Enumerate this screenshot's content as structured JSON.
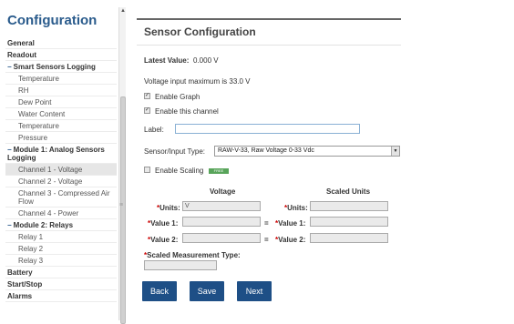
{
  "sidebar": {
    "title": "Configuration",
    "items": [
      {
        "label": "General",
        "kind": "lvl0"
      },
      {
        "label": "Readout",
        "kind": "lvl0"
      },
      {
        "label": "Smart Sensors Logging",
        "kind": "group"
      },
      {
        "label": "Temperature",
        "kind": "sub"
      },
      {
        "label": "RH",
        "kind": "sub"
      },
      {
        "label": "Dew Point",
        "kind": "sub"
      },
      {
        "label": "Water Content",
        "kind": "sub"
      },
      {
        "label": "Temperature",
        "kind": "sub"
      },
      {
        "label": "Pressure",
        "kind": "sub"
      },
      {
        "label": "Module 1: Analog Sensors Logging",
        "kind": "group-two"
      },
      {
        "label": "Channel 1 - Voltage",
        "kind": "sub-active"
      },
      {
        "label": "Channel 2 - Voltage",
        "kind": "sub"
      },
      {
        "label": "Channel 3 - Compressed Air Flow",
        "kind": "sub-two"
      },
      {
        "label": "Channel 4 - Power",
        "kind": "sub"
      },
      {
        "label": "Module 2: Relays",
        "kind": "group"
      },
      {
        "label": "Relay 1",
        "kind": "sub"
      },
      {
        "label": "Relay 2",
        "kind": "sub"
      },
      {
        "label": "Relay 3",
        "kind": "sub"
      },
      {
        "label": "Battery",
        "kind": "lvl0"
      },
      {
        "label": "Start/Stop",
        "kind": "lvl0"
      },
      {
        "label": "Alarms",
        "kind": "lvl0"
      }
    ],
    "collapse_glyph": "−",
    "scroll_up_glyph": "▲",
    "grip_glyph": "≡"
  },
  "panel": {
    "title": "Sensor Configuration",
    "latest_label": "Latest Value:",
    "latest_value": "0.000 V",
    "voltage_note": "Voltage input maximum is 33.0 V",
    "enable_graph": "Enable Graph",
    "enable_channel": "Enable this channel",
    "label_label": "Label:",
    "label_value": "",
    "sensor_type_label": "Sensor/Input Type:",
    "sensor_type_value": "RAW-V-33, Raw Voltage 0-33 Vdc",
    "enable_scaling": "Enable Scaling",
    "scaling_badge": "FREE",
    "voltage_header": "Voltage",
    "scaled_header": "Scaled Units",
    "units_label": "Units:",
    "units_value": "V",
    "scaled_units_label": "Units:",
    "scaled_units_value": "",
    "value1_label": "Value 1:",
    "value2_label": "Value 2:",
    "equals": "=",
    "required_mark": "*",
    "scaled_type_label": "Scaled Measurement Type:",
    "check_glyph": "✓",
    "dropdown_glyph": "▼"
  },
  "buttons": {
    "back": "Back",
    "save": "Save",
    "next": "Next"
  }
}
